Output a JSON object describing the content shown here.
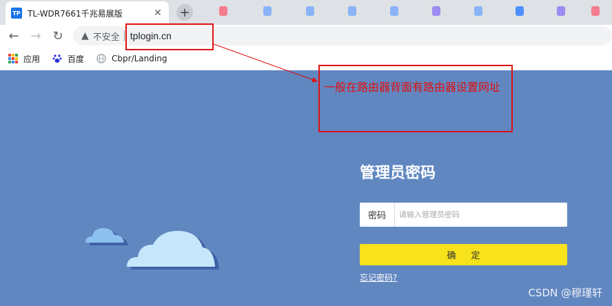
{
  "tab": {
    "favicon_text": "TP",
    "title": "TL-WDR7661千兆易展版",
    "close": "✕",
    "new_tab": "+"
  },
  "tab_decorations": [
    {
      "color": "#f57c8e"
    },
    {
      "color": "#8ab4f8"
    },
    {
      "color": "#8ab4f8"
    },
    {
      "color": "#8ab4f8"
    },
    {
      "color": "#8ab4f8"
    },
    {
      "color": "#9c8bf0"
    },
    {
      "color": "#8ab4f8"
    },
    {
      "color": "#4d90fe"
    },
    {
      "color": "#9c8bf0"
    },
    {
      "color": "#f57c8e"
    }
  ],
  "toolbar": {
    "back": "←",
    "forward": "→",
    "reload": "↻",
    "security_icon": "▲",
    "security_label": "不安全",
    "url": "tplogin.cn"
  },
  "bookmarks": [
    {
      "label": "应用",
      "icon": "apps-grid-icon"
    },
    {
      "label": "百度",
      "icon": "baidu-paw-icon"
    },
    {
      "label": "Cbpr/Landing",
      "icon": "globe-icon"
    }
  ],
  "annotation": {
    "text": "一般在路由器背面有路由器设置网址",
    "color": "#e01010"
  },
  "login": {
    "title": "管理员密码",
    "password_label": "密码",
    "password_placeholder": "请输入管理员密码",
    "confirm_label": "确定",
    "forgot_label": "忘记密码?"
  },
  "watermark": "CSDN @穆瑾轩",
  "colors": {
    "page_bg": "#6187c1",
    "button": "#f7e21b",
    "cloud_light": "#c6e6fb",
    "cloud_shadow": "#3f62a6"
  }
}
